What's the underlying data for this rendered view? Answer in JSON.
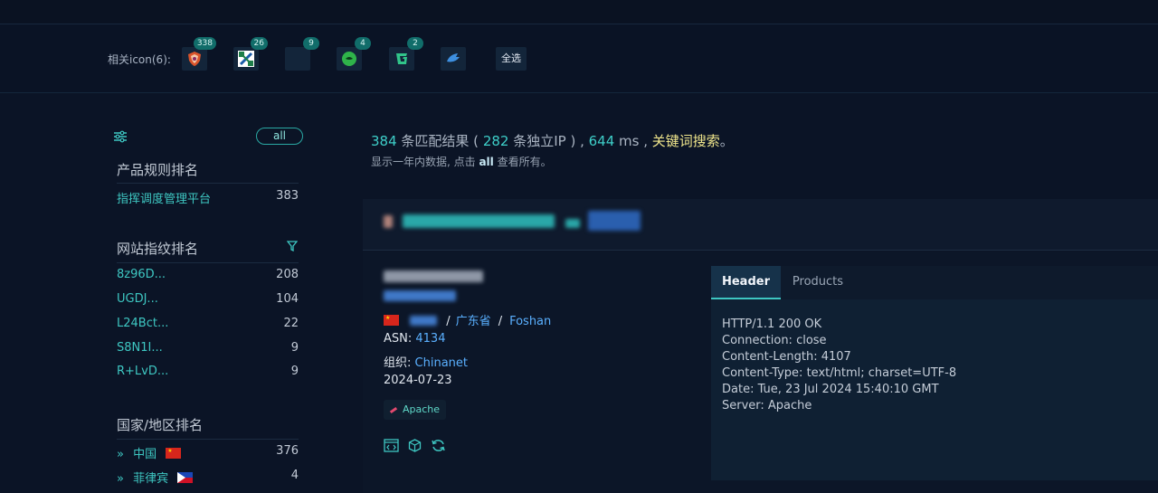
{
  "iconbar": {
    "label": "相关icon(6):",
    "icons": [
      {
        "name": "icon-1",
        "badge": "338"
      },
      {
        "name": "icon-2",
        "badge": "26"
      },
      {
        "name": "icon-3",
        "badge": "9"
      },
      {
        "name": "icon-4",
        "badge": "4"
      },
      {
        "name": "icon-5",
        "badge": "2"
      },
      {
        "name": "icon-6",
        "badge": ""
      }
    ],
    "select_all": "全选"
  },
  "sidebar": {
    "all_button": "all",
    "product_title": "产品规则排名",
    "products": [
      {
        "label": "指挥调度管理平台",
        "count": "383"
      }
    ],
    "fingerprint_title": "网站指纹排名",
    "fingerprints": [
      {
        "label": "8z96D...",
        "count": "208"
      },
      {
        "label": "UGDJ...",
        "count": "104"
      },
      {
        "label": "L24Bct...",
        "count": "22"
      },
      {
        "label": "S8N1I...",
        "count": "9"
      },
      {
        "label": "R+LvD...",
        "count": "9"
      }
    ],
    "country_title": "国家/地区排名",
    "countries": [
      {
        "label": "中国",
        "count": "376",
        "flag": "cn"
      },
      {
        "label": "菲律宾",
        "count": "4",
        "flag": "ph"
      }
    ]
  },
  "summary": {
    "results": "384",
    "results_text": " 条匹配结果 ( ",
    "ips": "282",
    "ips_text": " 条独立IP ) , ",
    "ms": "644",
    "ms_text": " ms , ",
    "keyword": "关键词搜索",
    "end": "。",
    "sub_pre": "显示一年内数据, 点击 ",
    "sub_all": "all",
    "sub_post": " 查看所有。"
  },
  "result": {
    "location_region": "广东省",
    "location_city": "Foshan",
    "asn_label": "ASN:",
    "asn": "4134",
    "org_label": "组织:",
    "org": "Chinanet",
    "date": "2024-07-23",
    "tag": "Apache",
    "sep": "/",
    "tabs": {
      "header": "Header",
      "products": "Products"
    },
    "header_lines": [
      "HTTP/1.1 200 OK",
      "Connection: close",
      "Content-Length: 4107",
      "Content-Type: text/html; charset=UTF-8",
      "Date: Tue, 23 Jul 2024 15:40:10 GMT",
      "Server: Apache"
    ]
  },
  "colors": {
    "accent": "#3ec7c2",
    "link": "#5ab0ff",
    "keyword": "#f0e68c",
    "background": "#0b1426"
  }
}
